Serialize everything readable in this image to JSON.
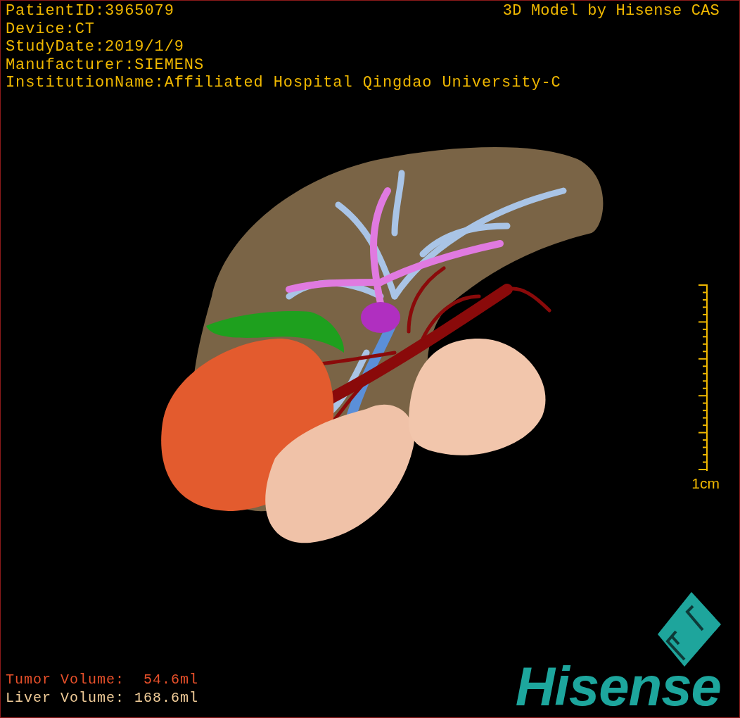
{
  "info_lines": [
    "PatientID:3965079",
    "Device:CT",
    "StudyDate:2019/1/9",
    "Manufacturer:SIEMENS",
    "InstitutionName:Affiliated Hospital Qingdao University-C"
  ],
  "title": "3D Model by Hisense CAS",
  "scale_bar": {
    "label": "1cm"
  },
  "volumes": [
    {
      "kind": "tumor",
      "label": "Tumor Volume:",
      "value": "54.6ml"
    },
    {
      "kind": "liver",
      "label": "Liver Volume:",
      "value": "168.6ml"
    }
  ],
  "logo": {
    "text": "Hisense"
  }
}
